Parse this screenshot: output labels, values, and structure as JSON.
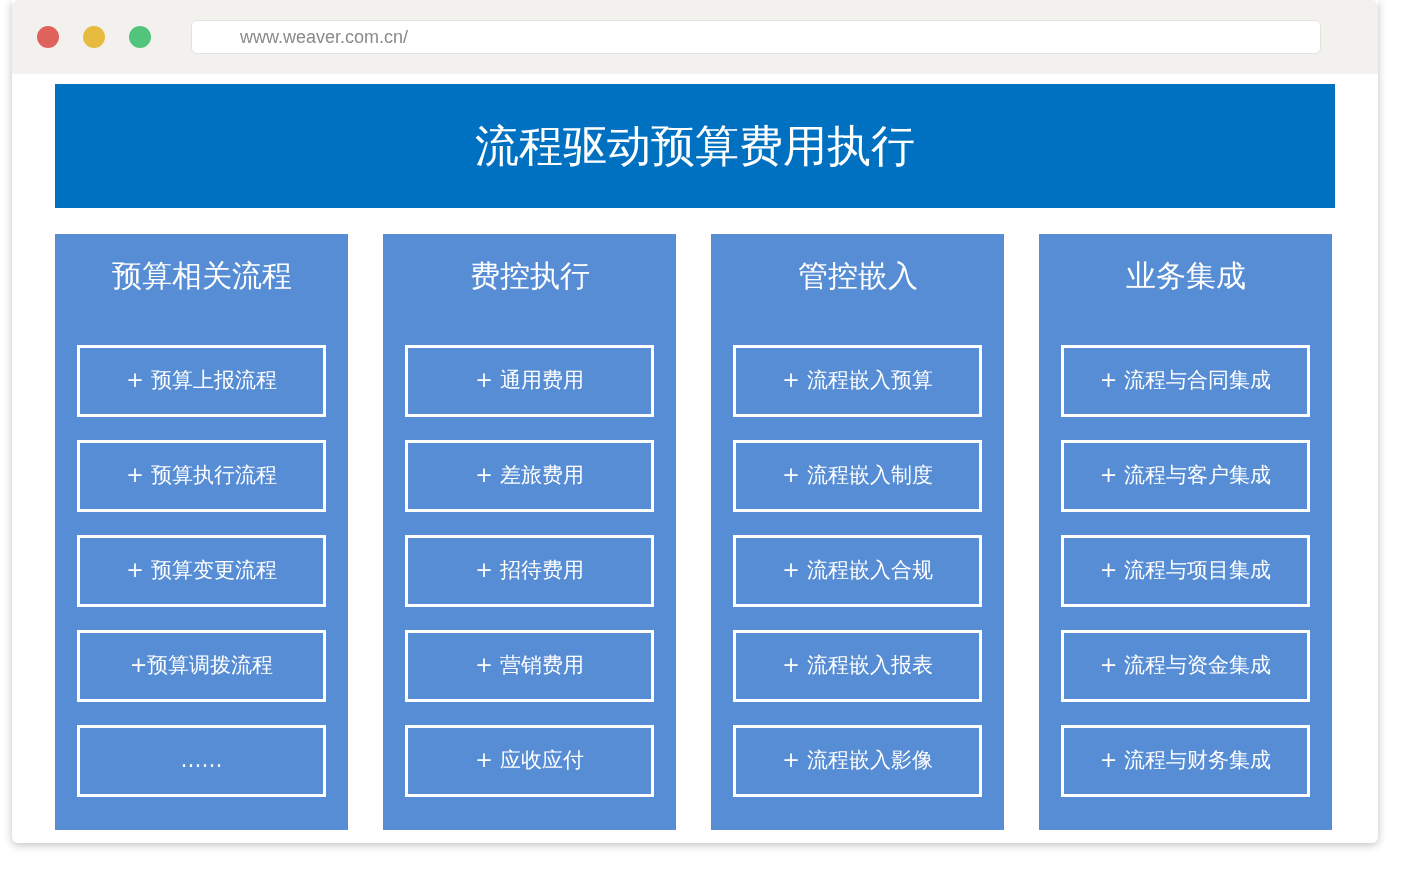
{
  "browser": {
    "url": "www.weaver.com.cn/"
  },
  "banner": {
    "title": "流程驱动预算费用执行"
  },
  "columns": [
    {
      "title": "预算相关流程",
      "items": [
        "+ 预算上报流程",
        "+ 预算执行流程",
        "+ 预算变更流程",
        "+预算调拨流程",
        "……"
      ]
    },
    {
      "title": "费控执行",
      "items": [
        "+ 通用费用",
        "+ 差旅费用",
        "+ 招待费用",
        "+ 营销费用",
        "+ 应收应付"
      ]
    },
    {
      "title": "管控嵌入",
      "items": [
        "+ 流程嵌入预算",
        "+ 流程嵌入制度",
        "+ 流程嵌入合规",
        "+ 流程嵌入报表",
        "+ 流程嵌入影像"
      ]
    },
    {
      "title": "业务集成",
      "items": [
        "+ 流程与合同集成",
        "+ 流程与客户集成",
        "+ 流程与项目集成",
        "+ 流程与资金集成",
        "+ 流程与财务集成"
      ]
    }
  ]
}
